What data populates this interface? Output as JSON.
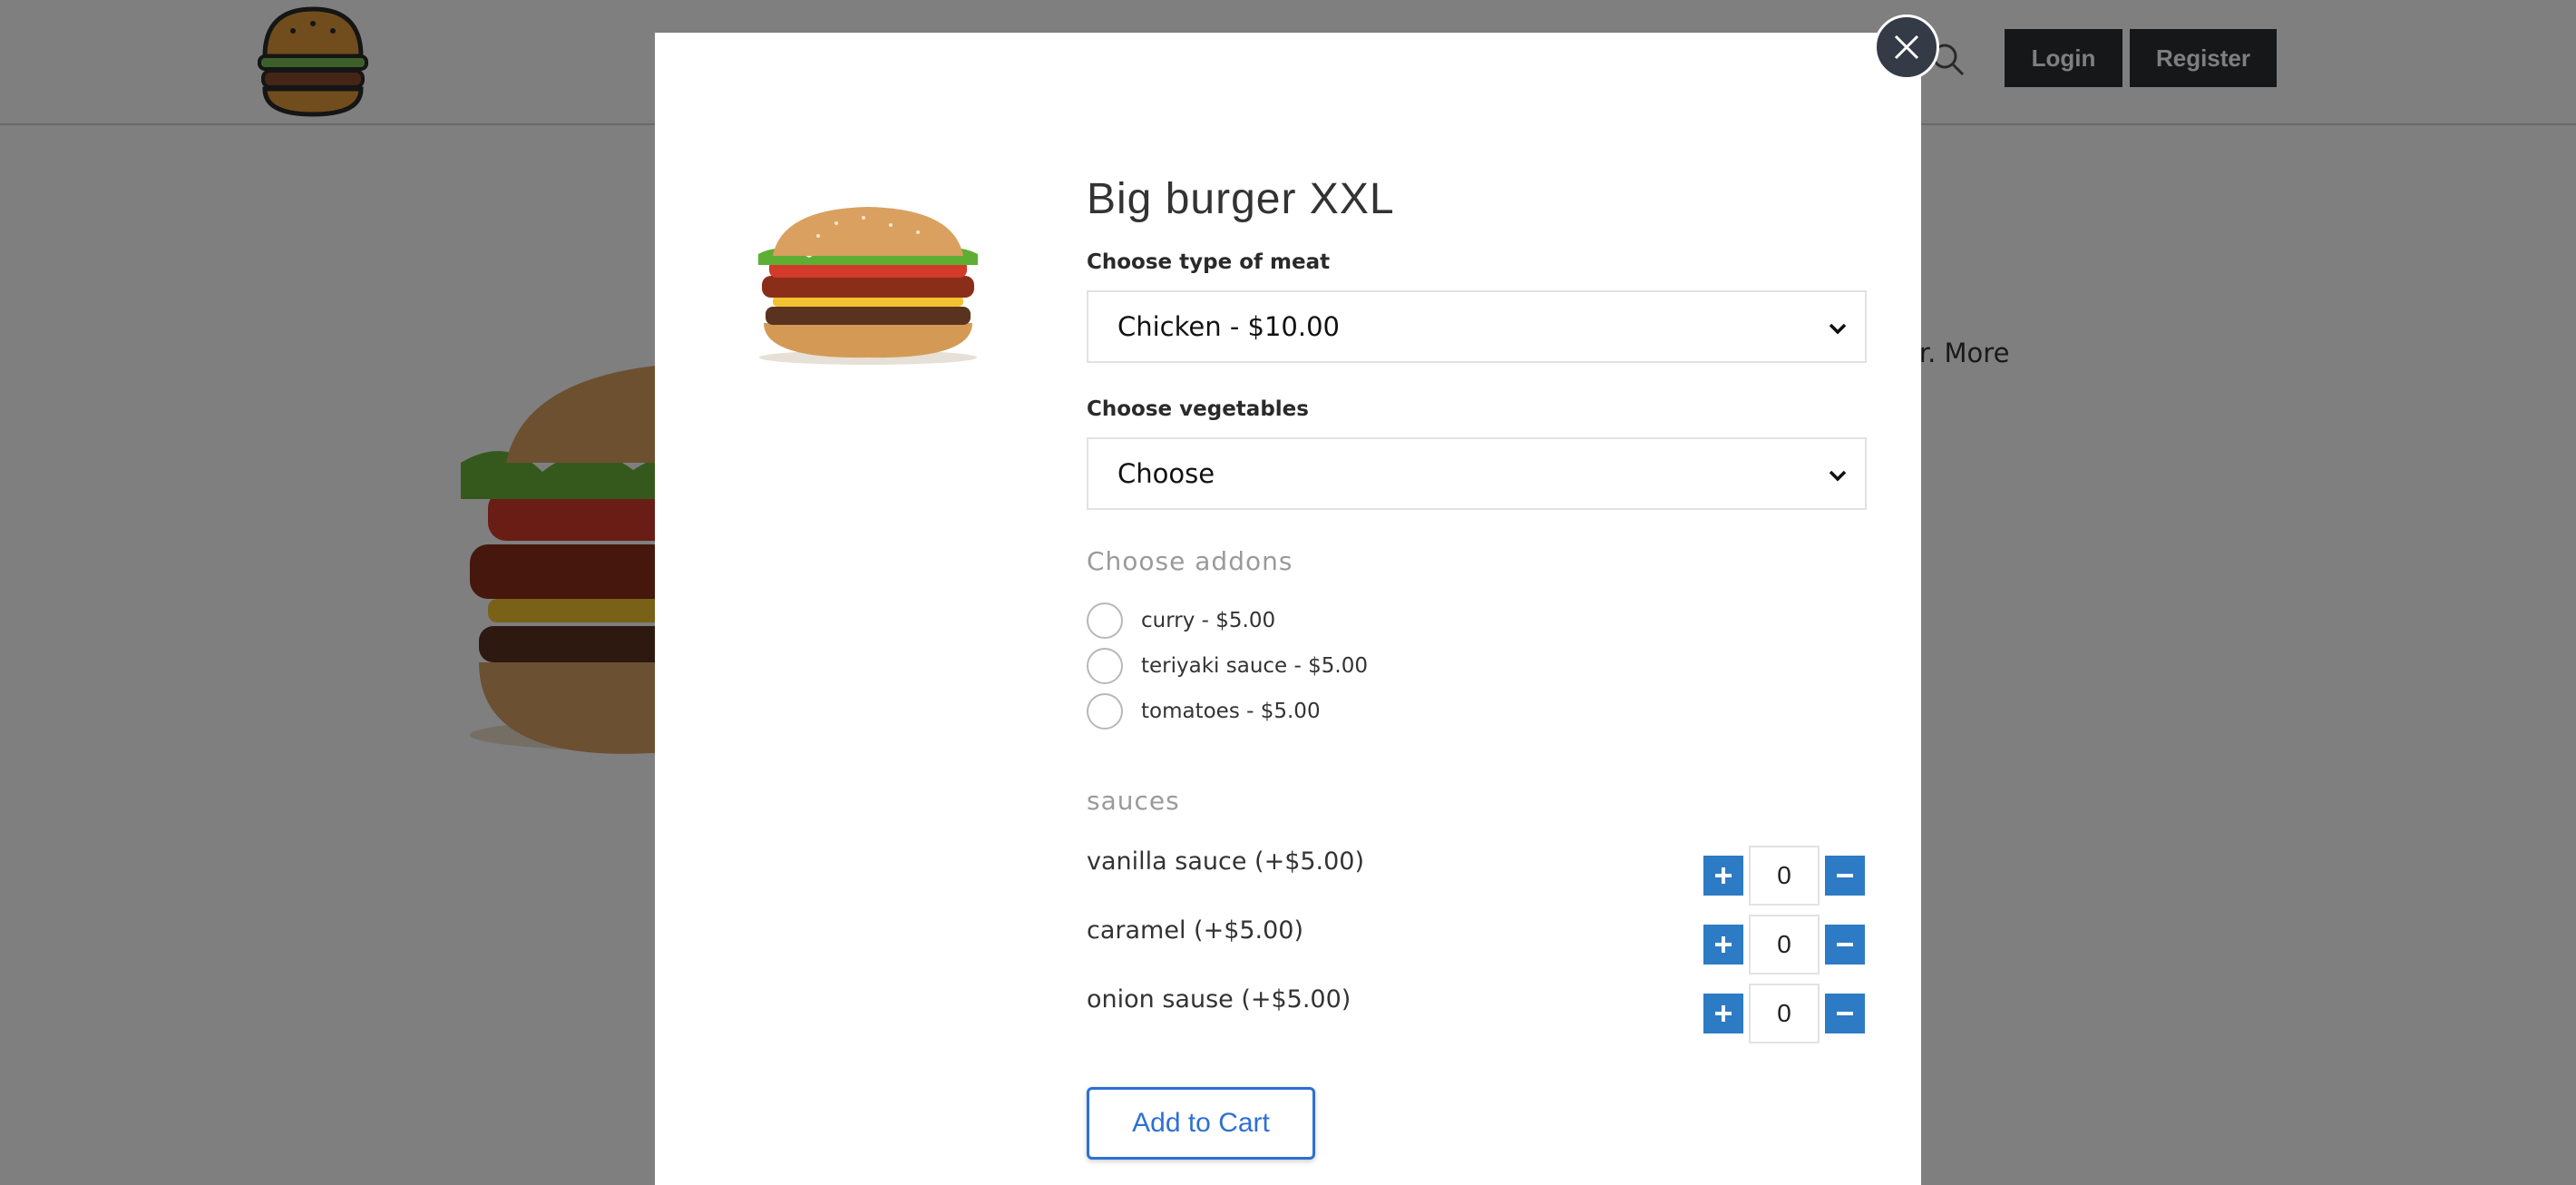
{
  "header": {
    "login_label": "Login",
    "register_label": "Register",
    "logo_icon": "burger-logo-icon",
    "search_icon": "search-icon"
  },
  "background": {
    "hero_text": "er. More"
  },
  "modal": {
    "title": "Big burger XXL",
    "close_icon": "close-icon",
    "meat": {
      "label": "Choose type of meat",
      "selected": "Chicken - $10.00"
    },
    "vegetables": {
      "label": "Choose vegetables",
      "selected": "Choose"
    },
    "addons": {
      "label": "Choose addons",
      "items": [
        {
          "label": "curry - $5.00",
          "checked": false
        },
        {
          "label": "teriyaki sauce - $5.00",
          "checked": false
        },
        {
          "label": "tomatoes - $5.00",
          "checked": false
        }
      ]
    },
    "sauces": {
      "label": "sauces",
      "items": [
        {
          "name": "vanilla sauce (+$5.00)",
          "qty": "0"
        },
        {
          "name": "caramel (+$5.00)",
          "qty": "0"
        },
        {
          "name": "onion sause (+$5.00)",
          "qty": "0"
        }
      ]
    },
    "add_to_cart_label": "Add to Cart"
  },
  "colors": {
    "accent_blue": "#2d7bc4",
    "cart_border": "#2e6fd4",
    "header_button": "#2b2f33",
    "close_button": "#343a46"
  }
}
